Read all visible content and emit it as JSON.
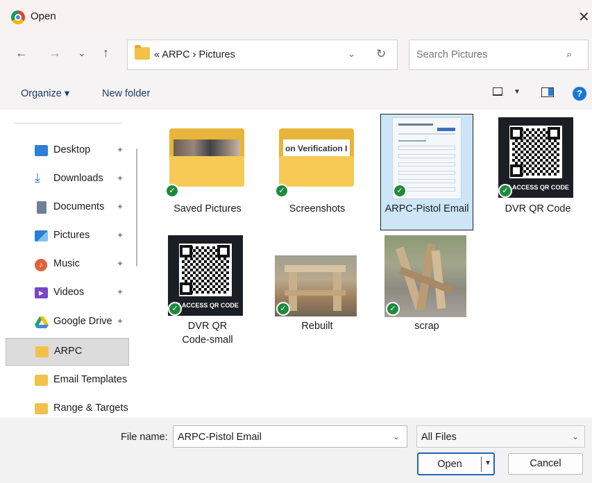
{
  "window": {
    "title": "Open",
    "close_label": "✕"
  },
  "nav": {
    "back": "←",
    "forward": "→",
    "recent": "⌄",
    "up": "↑",
    "address": "« ARPC › Pictures",
    "address_chevron": "⌄",
    "refresh": "↻",
    "search_placeholder": "Search Pictures",
    "search_icon": "⌕"
  },
  "commands": {
    "organize": "Organize ▾",
    "new_folder": "New folder",
    "help": "?"
  },
  "sidebar": {
    "items": [
      {
        "label": "Desktop",
        "icon": "desktop-icon",
        "pinned": true,
        "color": "#2d7fd3"
      },
      {
        "label": "Downloads",
        "icon": "download-icon",
        "pinned": true,
        "color": "#1f7fd0"
      },
      {
        "label": "Documents",
        "icon": "document-icon",
        "pinned": true,
        "color": "#6f7f95"
      },
      {
        "label": "Pictures",
        "icon": "pictures-icon",
        "pinned": true,
        "color": "#2a7fd4"
      },
      {
        "label": "Music",
        "icon": "music-icon",
        "pinned": true,
        "color": "#e0613b"
      },
      {
        "label": "Videos",
        "icon": "videos-icon",
        "pinned": true,
        "color": "#7a45c9"
      },
      {
        "label": "Google Drive",
        "icon": "google-drive-icon",
        "pinned": true,
        "color": "#1fa463"
      },
      {
        "label": "ARPC",
        "icon": "folder-icon",
        "pinned": false,
        "color": "#f2c14a"
      },
      {
        "label": "Email Templates",
        "icon": "folder-icon",
        "pinned": false,
        "color": "#f2c14a"
      },
      {
        "label": "Range & Targets",
        "icon": "folder-icon",
        "pinned": false,
        "color": "#f2c14a"
      }
    ],
    "pin_glyph": "📌",
    "selected_index": 7
  },
  "files": [
    {
      "label": "Saved Pictures",
      "kind": "folder-photo"
    },
    {
      "label": "Screenshots",
      "kind": "folder-screenshot",
      "preview_text": "on Verification I"
    },
    {
      "label": "ARPC-Pistol Email",
      "kind": "document",
      "selected": true
    },
    {
      "label": "DVR QR Code",
      "kind": "qr",
      "qr_caption": "LE ACCESS QR CODE"
    },
    {
      "label": "DVR QR Code-small",
      "kind": "qr",
      "qr_caption": "LE ACCESS QR CODE"
    },
    {
      "label": "Rebuilt",
      "kind": "photo-wood"
    },
    {
      "label": "scrap",
      "kind": "photo-scrap"
    }
  ],
  "bottom": {
    "file_name_label": "File name:",
    "file_name_value": "ARPC-Pistol Email",
    "file_type": "All Files",
    "open_label": "Open",
    "cancel_label": "Cancel"
  },
  "colors": {
    "accent": "#2563b8",
    "sync_check": "#1e8a3d",
    "selection": "#cde6f7"
  }
}
